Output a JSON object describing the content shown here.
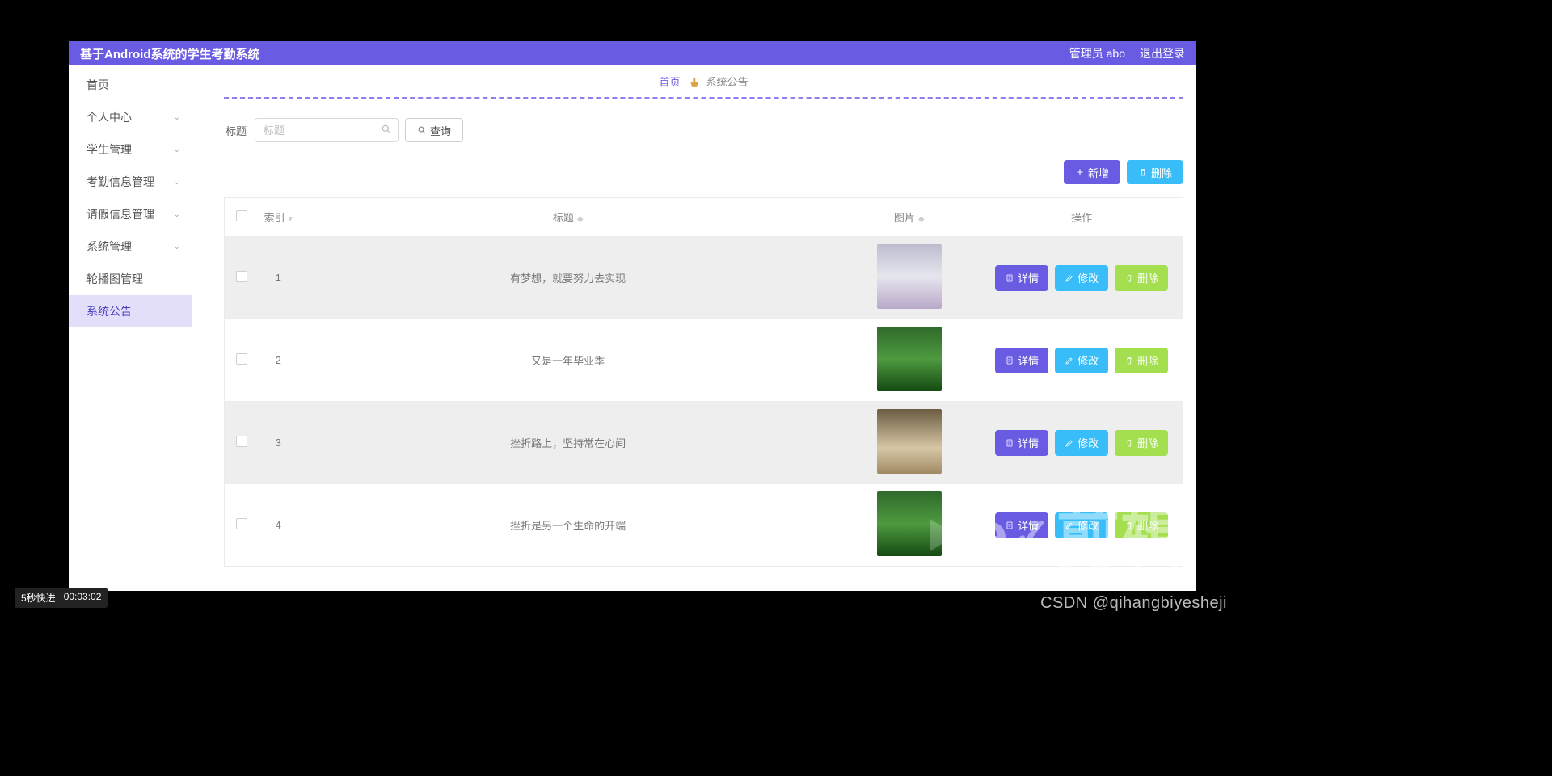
{
  "topbar": {
    "title": "基于Android系统的学生考勤系统",
    "user": "管理员 abo",
    "logout": "退出登录"
  },
  "sidebar": {
    "items": [
      {
        "label": "首页",
        "expandable": false,
        "active": false
      },
      {
        "label": "个人中心",
        "expandable": true,
        "active": false
      },
      {
        "label": "学生管理",
        "expandable": true,
        "active": false
      },
      {
        "label": "考勤信息管理",
        "expandable": true,
        "active": false
      },
      {
        "label": "请假信息管理",
        "expandable": true,
        "active": false
      },
      {
        "label": "系统管理",
        "expandable": true,
        "active": false
      },
      {
        "label": "轮播图管理",
        "expandable": false,
        "active": false
      },
      {
        "label": "系统公告",
        "expandable": false,
        "active": true
      }
    ]
  },
  "breadcrumb": {
    "home": "首页",
    "current": "系统公告"
  },
  "search": {
    "label": "标题",
    "placeholder": "标题",
    "query_btn": "查询"
  },
  "toolbar": {
    "add": "新增",
    "delete": "删除"
  },
  "table": {
    "headers": {
      "index": "索引",
      "title": "标题",
      "image": "图片",
      "ops": "操作"
    },
    "row_buttons": {
      "details": "详情",
      "edit": "修改",
      "delete": "删除"
    },
    "rows": [
      {
        "index": "1",
        "title": "有梦想，就要努力去实现",
        "thumb_class": "t1"
      },
      {
        "index": "2",
        "title": "又是一年毕业季",
        "thumb_class": "t2"
      },
      {
        "index": "3",
        "title": "挫折路上，坚持常在心间",
        "thumb_class": "t3"
      },
      {
        "index": "4",
        "title": "挫折是另一个生命的开端",
        "thumb_class": "t4"
      }
    ]
  },
  "video_overlay": {
    "skip": "5秒快进",
    "time": "00:03:02"
  },
  "watermark": {
    "csdn": "CSDN @qihangbiyesheji",
    "ev": "剪辑"
  }
}
